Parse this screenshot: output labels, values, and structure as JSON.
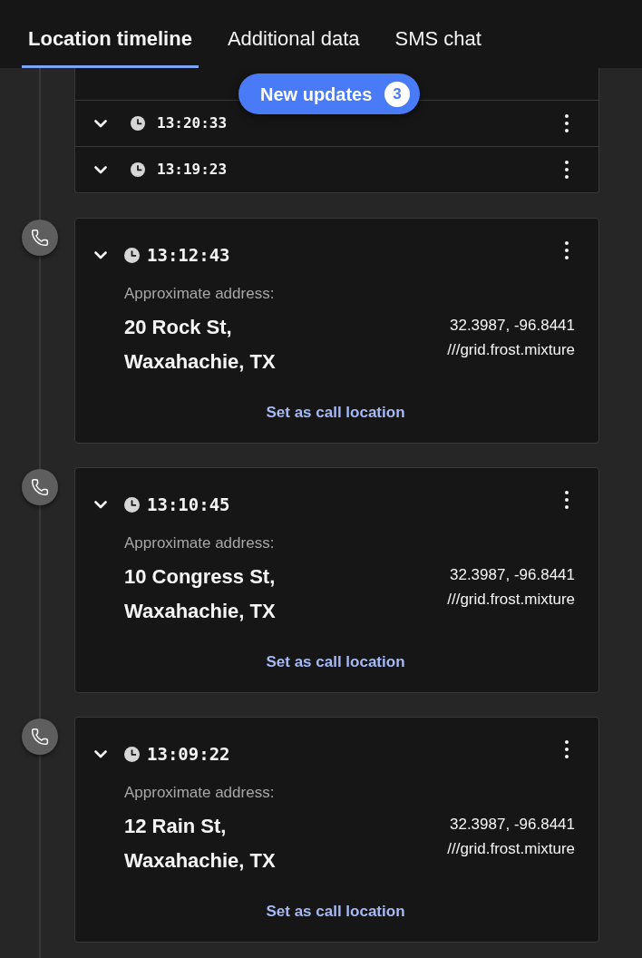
{
  "tabs": [
    {
      "label": "Location timeline",
      "selected": true
    },
    {
      "label": "Additional data",
      "selected": false
    },
    {
      "label": "SMS chat",
      "selected": false
    }
  ],
  "new_updates": {
    "label": "New updates",
    "count": "3"
  },
  "entries": [
    {
      "kind": "group",
      "rows": [
        {
          "time": "13:20:33"
        },
        {
          "time": "13:19:23"
        }
      ]
    },
    {
      "kind": "call",
      "time": "13:12:43",
      "address_label": "Approximate address:",
      "address": "20 Rock St, Waxahachie, TX",
      "coordinates": "32.3987, -96.8441",
      "what3words": "///grid.frost.mixture",
      "action": "Set as call location"
    },
    {
      "kind": "call",
      "time": "13:10:45",
      "address_label": "Approximate address:",
      "address": "10 Congress St, Waxahachie, TX",
      "coordinates": "32.3987, -96.8441",
      "what3words": "///grid.frost.mixture",
      "action": "Set as call location"
    },
    {
      "kind": "call",
      "time": "13:09:22",
      "address_label": "Approximate address:",
      "address": "12 Rain St, Waxahachie, TX",
      "coordinates": "32.3987, -96.8441",
      "what3words": "///grid.frost.mixture",
      "action": "Set as call location"
    }
  ]
}
